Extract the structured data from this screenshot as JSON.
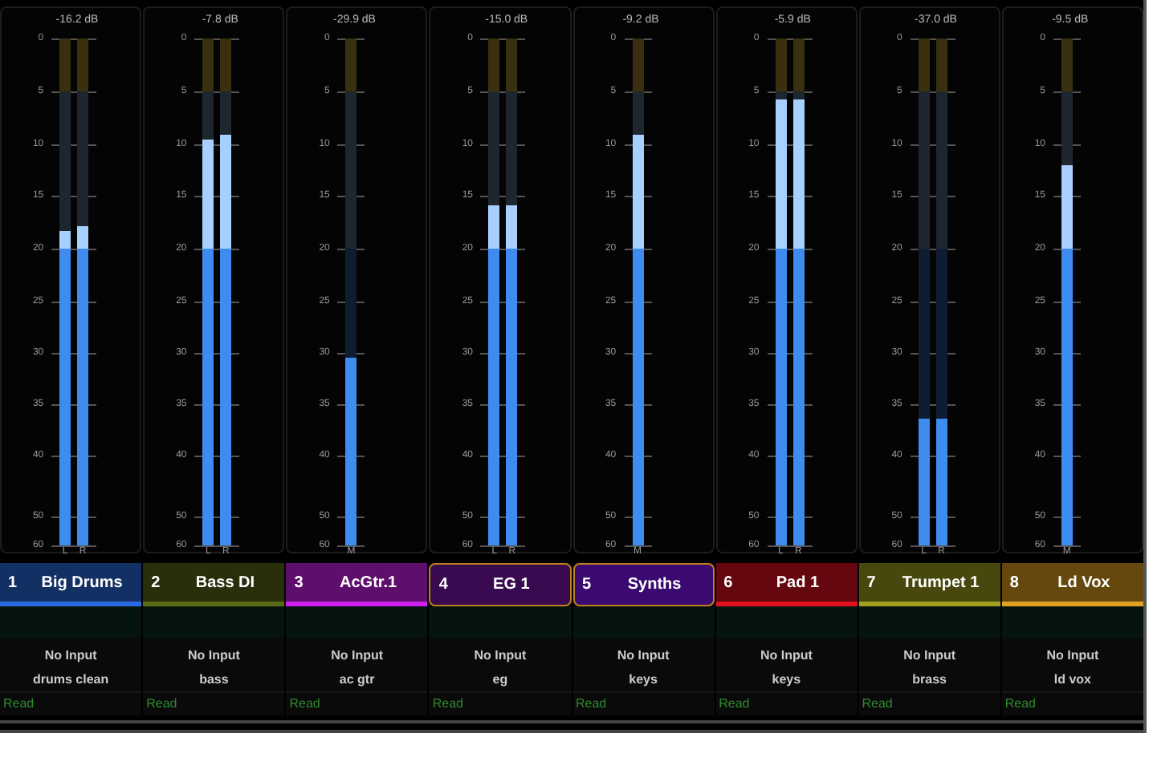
{
  "strips": [
    {
      "reading": "-16.2 dB",
      "scale": [
        "0",
        "5",
        "10",
        "15",
        "20",
        "25",
        "30",
        "35",
        "40",
        "50",
        "60"
      ],
      "meters": [
        {
          "label": "L",
          "level": 0.62
        },
        {
          "label": "R",
          "level": 0.63
        }
      ],
      "number": "1",
      "name": "Big Drums",
      "color": "#2a6ae0",
      "selected": false,
      "input": "No Input",
      "comment": "drums clean",
      "automation": "Read"
    },
    {
      "reading": "-7.8 dB",
      "scale": [
        "0",
        "5",
        "10",
        "15",
        "20",
        "25",
        "30",
        "35",
        "40",
        "50",
        "60"
      ],
      "meters": [
        {
          "label": "L",
          "level": 0.8
        },
        {
          "label": "R",
          "level": 0.81
        }
      ],
      "number": "2",
      "name": "Bass DI",
      "color": "#5b6816",
      "selected": false,
      "input": "No Input",
      "comment": "bass",
      "automation": "Read"
    },
    {
      "reading": "-29.9 dB",
      "scale": [
        "0",
        "5",
        "10",
        "15",
        "20",
        "25",
        "30",
        "35",
        "40",
        "50",
        "60"
      ],
      "meters": [
        {
          "label": "M",
          "level": 0.37
        }
      ],
      "number": "3",
      "name": "AcGtr.1",
      "color": "#d020f0",
      "selected": false,
      "input": "No Input",
      "comment": "ac gtr",
      "automation": "Read"
    },
    {
      "reading": "-15.0 dB",
      "scale": [
        "0",
        "5",
        "10",
        "15",
        "20",
        "25",
        "30",
        "35",
        "40",
        "50",
        "60"
      ],
      "meters": [
        {
          "label": "L",
          "level": 0.67
        },
        {
          "label": "R",
          "level": 0.67
        }
      ],
      "number": "4",
      "name": "EG 1",
      "color": "#3a0a50",
      "selected": true,
      "input": "No Input",
      "comment": "eg",
      "automation": "Read"
    },
    {
      "reading": "-9.2 dB",
      "scale": [
        "0",
        "5",
        "10",
        "15",
        "20",
        "25",
        "30",
        "35",
        "40",
        "50",
        "60"
      ],
      "meters": [
        {
          "label": "M",
          "level": 0.81
        }
      ],
      "number": "5",
      "name": "Synths",
      "color": "#3a0a70",
      "selected": true,
      "input": "No Input",
      "comment": "keys",
      "automation": "Read"
    },
    {
      "reading": "-5.9 dB",
      "scale": [
        "0",
        "5",
        "10",
        "15",
        "20",
        "25",
        "30",
        "35",
        "40",
        "50",
        "60"
      ],
      "meters": [
        {
          "label": "L",
          "level": 0.88
        },
        {
          "label": "R",
          "level": 0.88
        }
      ],
      "number": "6",
      "name": "Pad 1",
      "color": "#e01020",
      "selected": false,
      "input": "No Input",
      "comment": "keys",
      "automation": "Read"
    },
    {
      "reading": "-37.0 dB",
      "scale": [
        "0",
        "5",
        "10",
        "15",
        "20",
        "25",
        "30",
        "35",
        "40",
        "50",
        "60"
      ],
      "meters": [
        {
          "label": "L",
          "level": 0.25
        },
        {
          "label": "R",
          "level": 0.25
        }
      ],
      "number": "7",
      "name": "Trumpet 1",
      "color": "#a0a020",
      "selected": false,
      "input": "No Input",
      "comment": "brass",
      "automation": "Read"
    },
    {
      "reading": "-9.5 dB",
      "scale": [
        "0",
        "5",
        "10",
        "15",
        "20",
        "25",
        "30",
        "35",
        "40",
        "50",
        "60"
      ],
      "meters": [
        {
          "label": "M",
          "level": 0.75
        }
      ],
      "number": "8",
      "name": "Ld Vox",
      "color": "#e0a020",
      "selected": false,
      "input": "No Input",
      "comment": "ld vox",
      "automation": "Read"
    }
  ]
}
